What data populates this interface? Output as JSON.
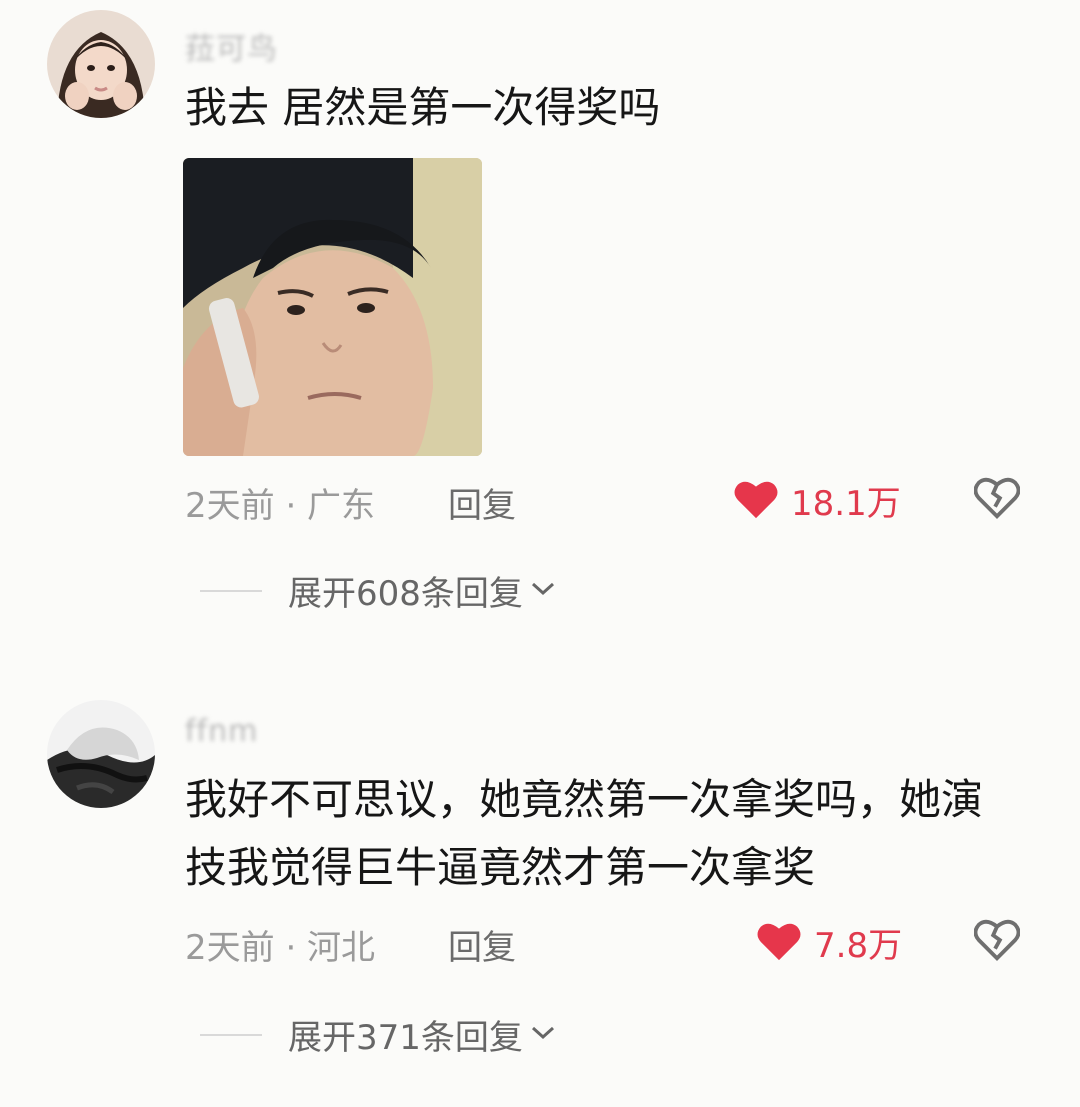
{
  "comments": [
    {
      "username": "菈可鸟",
      "text": "我去 居然是第一次得奖吗",
      "time_location": "2天前 · 广东",
      "reply_label": "回复",
      "likes": "18.1万",
      "expand_label": "展开608条回复"
    },
    {
      "username": "ffnm",
      "text_lines": [
        "我好不可思议，她竟然第一次拿奖吗，她演",
        "技我觉得巨牛逼竟然才第一次拿奖"
      ],
      "time_location": "2天前 · 河北",
      "reply_label": "回复",
      "likes": "7.8万",
      "expand_label": "展开371条回复"
    }
  ],
  "colors": {
    "like": "#e03a4d",
    "meta": "#9a9a9a",
    "text": "#161616"
  },
  "icons": [
    "heart-icon",
    "broken-heart-icon",
    "chevron-down-icon"
  ]
}
